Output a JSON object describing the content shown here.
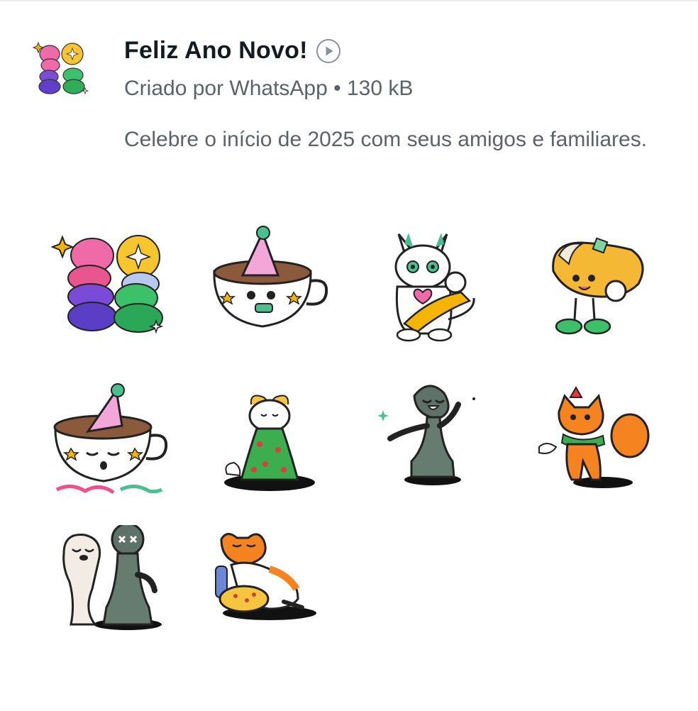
{
  "pack": {
    "title": "Feliz Ano Novo!",
    "creator": "Criado por WhatsApp • 130 kB",
    "description": "Celebre o início de 2025 com seus amigos e familiares.",
    "icon": "2025-balloon-sticker"
  },
  "icons": {
    "play": "play-icon"
  },
  "stickers": [
    {
      "name": "2025-balloon-sticker"
    },
    {
      "name": "coffee-cup-party-hat-sticker"
    },
    {
      "name": "lucky-cat-fish-sticker"
    },
    {
      "name": "fortune-cookie-sticker"
    },
    {
      "name": "coffee-cup-sleepy-sticker"
    },
    {
      "name": "cat-christmas-tree-sticker"
    },
    {
      "name": "chess-pawn-laughing-sticker"
    },
    {
      "name": "fox-scarf-sticker"
    },
    {
      "name": "chess-pieces-hug-sticker"
    },
    {
      "name": "cat-pizza-sticker"
    }
  ],
  "colors": {
    "title": "#111b21",
    "secondary_text": "#5b6368",
    "background": "#ffffff"
  }
}
